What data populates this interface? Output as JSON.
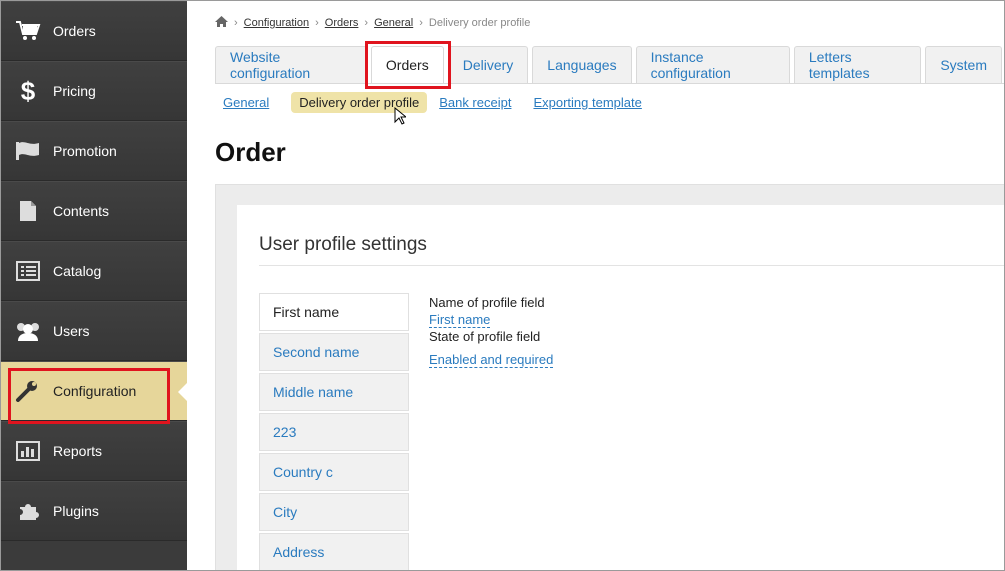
{
  "sidebar": {
    "items": [
      {
        "label": "Orders",
        "icon": "cart-icon"
      },
      {
        "label": "Pricing",
        "icon": "dollar-icon"
      },
      {
        "label": "Promotion",
        "icon": "flag-icon"
      },
      {
        "label": "Contents",
        "icon": "document-icon"
      },
      {
        "label": "Catalog",
        "icon": "list-icon"
      },
      {
        "label": "Users",
        "icon": "users-icon"
      },
      {
        "label": "Configuration",
        "icon": "wrench-icon"
      },
      {
        "label": "Reports",
        "icon": "bar-chart-icon"
      },
      {
        "label": "Plugins",
        "icon": "puzzle-icon"
      }
    ],
    "active_index": 6
  },
  "breadcrumb": {
    "items": [
      "Configuration",
      "Orders",
      "General"
    ],
    "current": "Delivery order profile"
  },
  "tabs": [
    {
      "label": "Website configuration"
    },
    {
      "label": "Orders"
    },
    {
      "label": "Delivery"
    },
    {
      "label": "Languages"
    },
    {
      "label": "Instance configuration"
    },
    {
      "label": "Letters templates"
    },
    {
      "label": "System"
    }
  ],
  "active_tab_index": 1,
  "subtabs": [
    {
      "label": "General"
    },
    {
      "label": "Delivery order profile"
    },
    {
      "label": "Bank receipt"
    },
    {
      "label": "Exporting template"
    }
  ],
  "active_subtab_index": 1,
  "page_title": "Order",
  "section_title": "User profile settings",
  "fields": [
    {
      "label": "First name"
    },
    {
      "label": "Second name"
    },
    {
      "label": "Middle name"
    },
    {
      "label": "223"
    },
    {
      "label": "Country c"
    },
    {
      "label": "City"
    },
    {
      "label": "Address"
    }
  ],
  "active_field_index": 0,
  "details": {
    "name_label": "Name of profile field",
    "name_value": "First name",
    "state_label": "State of profile field",
    "state_value": "Enabled and required"
  },
  "colors": {
    "sidebar_bg": "#3b3b3b",
    "active_highlight": "#e6d69a",
    "link": "#2a7bbf",
    "annotation_red": "#e0141e"
  }
}
